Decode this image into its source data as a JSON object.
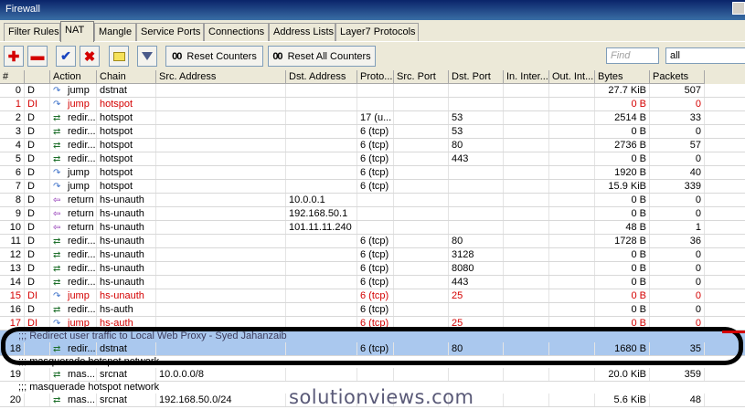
{
  "window": {
    "title": "Firewall"
  },
  "tabs": [
    {
      "label": "Filter Rules",
      "active": false
    },
    {
      "label": "NAT",
      "active": true
    },
    {
      "label": "Mangle",
      "active": false
    },
    {
      "label": "Service Ports",
      "active": false
    },
    {
      "label": "Connections",
      "active": false
    },
    {
      "label": "Address Lists",
      "active": false
    },
    {
      "label": "Layer7 Protocols",
      "active": false
    }
  ],
  "toolbar": {
    "add_icon": "plus-icon",
    "remove_icon": "minus-icon",
    "enable_icon": "check-icon",
    "disable_icon": "x-icon",
    "comment_icon": "note-icon",
    "filter_icon": "funnel-icon",
    "reset_counters_label": "Reset Counters",
    "reset_all_counters_label": "Reset All Counters",
    "counter_prefix": "00",
    "find_placeholder": "Find",
    "filter_value": "all"
  },
  "columns": [
    "#",
    "",
    "Action",
    "Chain",
    "Src. Address",
    "Dst. Address",
    "Proto...",
    "Src. Port",
    "Dst. Port",
    "In. Inter...",
    "Out. Int...",
    "Bytes",
    "Packets"
  ],
  "rows": [
    {
      "num": "0",
      "flag": "D",
      "action": "jump",
      "icon": "jump",
      "chain": "dstnat",
      "src": "",
      "dst": "",
      "proto": "",
      "sport": "",
      "dport": "",
      "in": "",
      "out": "",
      "bytes": "27.7 KiB",
      "packets": "507",
      "disabled": false
    },
    {
      "num": "1",
      "flag": "DI",
      "action": "jump",
      "icon": "jump",
      "chain": "hotspot",
      "src": "",
      "dst": "",
      "proto": "",
      "sport": "",
      "dport": "",
      "in": "",
      "out": "",
      "bytes": "0 B",
      "packets": "0",
      "disabled": true
    },
    {
      "num": "2",
      "flag": "D",
      "action": "redir...",
      "icon": "redir",
      "chain": "hotspot",
      "src": "",
      "dst": "",
      "proto": "17 (u...",
      "sport": "",
      "dport": "53",
      "in": "",
      "out": "",
      "bytes": "2514 B",
      "packets": "33",
      "disabled": false
    },
    {
      "num": "3",
      "flag": "D",
      "action": "redir...",
      "icon": "redir",
      "chain": "hotspot",
      "src": "",
      "dst": "",
      "proto": "6 (tcp)",
      "sport": "",
      "dport": "53",
      "in": "",
      "out": "",
      "bytes": "0 B",
      "packets": "0",
      "disabled": false
    },
    {
      "num": "4",
      "flag": "D",
      "action": "redir...",
      "icon": "redir",
      "chain": "hotspot",
      "src": "",
      "dst": "",
      "proto": "6 (tcp)",
      "sport": "",
      "dport": "80",
      "in": "",
      "out": "",
      "bytes": "2736 B",
      "packets": "57",
      "disabled": false
    },
    {
      "num": "5",
      "flag": "D",
      "action": "redir...",
      "icon": "redir",
      "chain": "hotspot",
      "src": "",
      "dst": "",
      "proto": "6 (tcp)",
      "sport": "",
      "dport": "443",
      "in": "",
      "out": "",
      "bytes": "0 B",
      "packets": "0",
      "disabled": false
    },
    {
      "num": "6",
      "flag": "D",
      "action": "jump",
      "icon": "jump",
      "chain": "hotspot",
      "src": "",
      "dst": "",
      "proto": "6 (tcp)",
      "sport": "",
      "dport": "",
      "in": "",
      "out": "",
      "bytes": "1920 B",
      "packets": "40",
      "disabled": false
    },
    {
      "num": "7",
      "flag": "D",
      "action": "jump",
      "icon": "jump",
      "chain": "hotspot",
      "src": "",
      "dst": "",
      "proto": "6 (tcp)",
      "sport": "",
      "dport": "",
      "in": "",
      "out": "",
      "bytes": "15.9 KiB",
      "packets": "339",
      "disabled": false
    },
    {
      "num": "8",
      "flag": "D",
      "action": "return",
      "icon": "ret",
      "chain": "hs-unauth",
      "src": "",
      "dst": "10.0.0.1",
      "proto": "",
      "sport": "",
      "dport": "",
      "in": "",
      "out": "",
      "bytes": "0 B",
      "packets": "0",
      "disabled": false
    },
    {
      "num": "9",
      "flag": "D",
      "action": "return",
      "icon": "ret",
      "chain": "hs-unauth",
      "src": "",
      "dst": "192.168.50.1",
      "proto": "",
      "sport": "",
      "dport": "",
      "in": "",
      "out": "",
      "bytes": "0 B",
      "packets": "0",
      "disabled": false
    },
    {
      "num": "10",
      "flag": "D",
      "action": "return",
      "icon": "ret",
      "chain": "hs-unauth",
      "src": "",
      "dst": "101.11.11.240",
      "proto": "",
      "sport": "",
      "dport": "",
      "in": "",
      "out": "",
      "bytes": "48 B",
      "packets": "1",
      "disabled": false
    },
    {
      "num": "11",
      "flag": "D",
      "action": "redir...",
      "icon": "redir",
      "chain": "hs-unauth",
      "src": "",
      "dst": "",
      "proto": "6 (tcp)",
      "sport": "",
      "dport": "80",
      "in": "",
      "out": "",
      "bytes": "1728 B",
      "packets": "36",
      "disabled": false
    },
    {
      "num": "12",
      "flag": "D",
      "action": "redir...",
      "icon": "redir",
      "chain": "hs-unauth",
      "src": "",
      "dst": "",
      "proto": "6 (tcp)",
      "sport": "",
      "dport": "3128",
      "in": "",
      "out": "",
      "bytes": "0 B",
      "packets": "0",
      "disabled": false
    },
    {
      "num": "13",
      "flag": "D",
      "action": "redir...",
      "icon": "redir",
      "chain": "hs-unauth",
      "src": "",
      "dst": "",
      "proto": "6 (tcp)",
      "sport": "",
      "dport": "8080",
      "in": "",
      "out": "",
      "bytes": "0 B",
      "packets": "0",
      "disabled": false
    },
    {
      "num": "14",
      "flag": "D",
      "action": "redir...",
      "icon": "redir",
      "chain": "hs-unauth",
      "src": "",
      "dst": "",
      "proto": "6 (tcp)",
      "sport": "",
      "dport": "443",
      "in": "",
      "out": "",
      "bytes": "0 B",
      "packets": "0",
      "disabled": false
    },
    {
      "num": "15",
      "flag": "DI",
      "action": "jump",
      "icon": "jump",
      "chain": "hs-unauth",
      "src": "",
      "dst": "",
      "proto": "6 (tcp)",
      "sport": "",
      "dport": "25",
      "in": "",
      "out": "",
      "bytes": "0 B",
      "packets": "0",
      "disabled": true
    },
    {
      "num": "16",
      "flag": "D",
      "action": "redir...",
      "icon": "redir",
      "chain": "hs-auth",
      "src": "",
      "dst": "",
      "proto": "6 (tcp)",
      "sport": "",
      "dport": "",
      "in": "",
      "out": "",
      "bytes": "0 B",
      "packets": "0",
      "disabled": false
    },
    {
      "num": "17",
      "flag": "DI",
      "action": "jump",
      "icon": "jump",
      "chain": "hs-auth",
      "src": "",
      "dst": "",
      "proto": "6 (tcp)",
      "sport": "",
      "dport": "25",
      "in": "",
      "out": "",
      "bytes": "0 B",
      "packets": "0",
      "disabled": true
    }
  ],
  "user_rows": [
    {
      "comment": ";;; Redirect user traffic to Local Web Proxy - Syed Jahanzaib",
      "num": "18",
      "flag": "",
      "action": "redir...",
      "icon": "redir",
      "chain": "dstnat",
      "src": "",
      "dst": "",
      "proto": "6 (tcp)",
      "sport": "",
      "dport": "80",
      "in": "",
      "out": "",
      "bytes": "1680 B",
      "packets": "35",
      "selected": true
    },
    {
      "comment": ";;; masquerade hotspot network",
      "num": "19",
      "flag": "",
      "action": "mas...",
      "icon": "redir",
      "chain": "srcnat",
      "src": "10.0.0.0/8",
      "dst": "",
      "proto": "",
      "sport": "",
      "dport": "",
      "in": "",
      "out": "",
      "bytes": "20.0 KiB",
      "packets": "359",
      "selected": false
    },
    {
      "comment": ";;; masquerade hotspot network",
      "num": "20",
      "flag": "",
      "action": "mas...",
      "icon": "redir",
      "chain": "srcnat",
      "src": "192.168.50.0/24",
      "dst": "",
      "proto": "",
      "sport": "",
      "dport": "",
      "in": "",
      "out": "",
      "bytes": "5.6 KiB",
      "packets": "48",
      "selected": false
    }
  ],
  "watermark": "solutionviews.com"
}
